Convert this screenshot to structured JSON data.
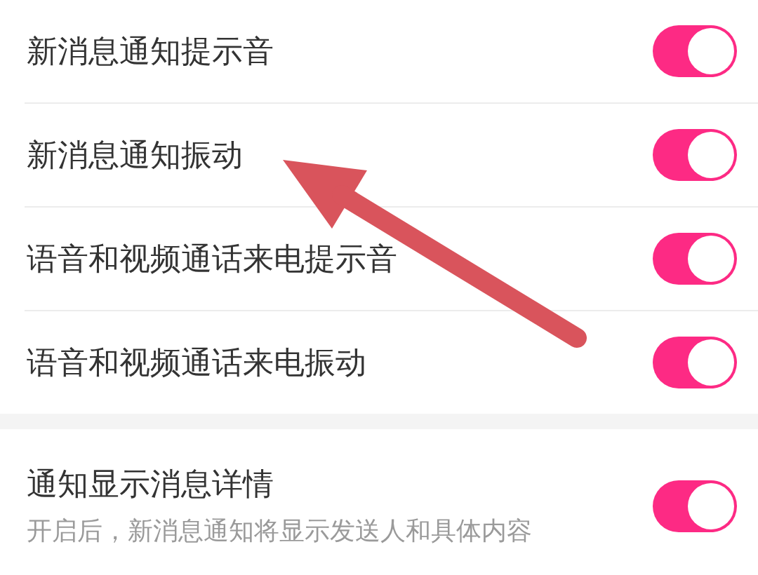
{
  "sections": [
    {
      "rows": [
        {
          "title": "新消息通知提示音",
          "on": true
        },
        {
          "title": "新消息通知振动",
          "on": true
        },
        {
          "title": "语音和视频通话来电提示音",
          "on": true
        },
        {
          "title": "语音和视频通话来电振动",
          "on": true
        }
      ]
    },
    {
      "rows": [
        {
          "title": "通知显示消息详情",
          "description": "开启后，新消息通知将显示发送人和具体内容",
          "on": true
        }
      ]
    }
  ]
}
